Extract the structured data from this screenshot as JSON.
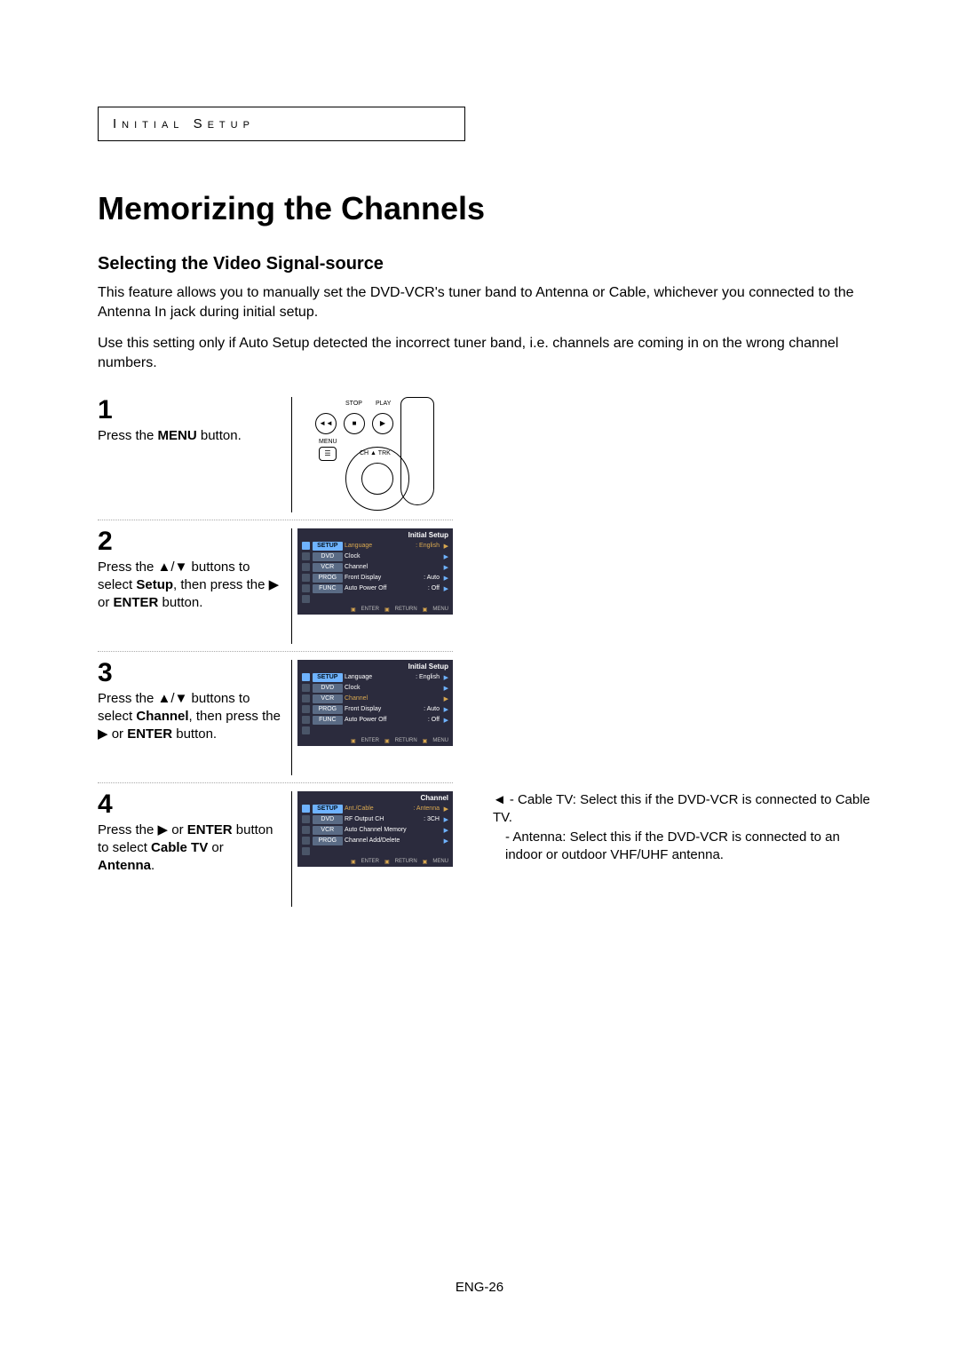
{
  "header": {
    "section": "Initial Setup"
  },
  "title": "Memorizing the Channels",
  "subtitle": "Selecting the Video Signal-source",
  "intro1": "This feature allows you to manually set the DVD-VCR's tuner band to Antenna or Cable, whichever you connected to the Antenna In jack during initial setup.",
  "intro2": "Use this setting only if Auto Setup detected the incorrect tuner band, i.e. channels are coming in on the wrong channel numbers.",
  "steps": {
    "s1": {
      "num": "1",
      "text_before": "Press the ",
      "bold1": "MENU",
      "text_after": " button."
    },
    "s2": {
      "num": "2",
      "text_a": "Press the ▲/▼ buttons to select ",
      "bold1": "Setup",
      "text_b": ", then press the ▶ or ",
      "bold2": "ENTER",
      "text_c": " button."
    },
    "s3": {
      "num": "3",
      "text_a": "Press the ▲/▼ buttons to select ",
      "bold1": "Channel",
      "text_b": ", then press the ▶ or ",
      "bold2": "ENTER",
      "text_c": " button."
    },
    "s4": {
      "num": "4",
      "text_a": "Press the ▶ or ",
      "bold1": "ENTER",
      "text_b": " button to select ",
      "bold2": "Cable TV",
      "text_c": " or ",
      "bold3": "Antenna",
      "text_d": "."
    }
  },
  "notes": {
    "n1": "Cable TV: Select this if the DVD-VCR is connected to Cable TV.",
    "n2": "Antenna: Select this if the DVD-VCR is connected to an indoor or outdoor VHF/UHF antenna."
  },
  "remote": {
    "stop": "STOP",
    "play": "PLAY",
    "menu": "MENU",
    "chtrk": "CH ▲ TRK"
  },
  "osd_sidebar": [
    "SETUP",
    "DVD",
    "VCR",
    "PROG",
    "FUNC"
  ],
  "osd2": {
    "title": "Initial Setup",
    "rows": [
      {
        "label": "Language",
        "val": ": English",
        "sel": true
      },
      {
        "label": "Clock",
        "val": ""
      },
      {
        "label": "Channel",
        "val": ""
      },
      {
        "label": "Front Display",
        "val": ": Auto"
      },
      {
        "label": "Auto Power Off",
        "val": ": Off"
      }
    ]
  },
  "osd3": {
    "title": "Initial Setup",
    "rows": [
      {
        "label": "Language",
        "val": ": English"
      },
      {
        "label": "Clock",
        "val": ""
      },
      {
        "label": "Channel",
        "val": "",
        "sel": true
      },
      {
        "label": "Front Display",
        "val": ": Auto"
      },
      {
        "label": "Auto Power Off",
        "val": ": Off"
      }
    ]
  },
  "osd4": {
    "title": "Channel",
    "rows": [
      {
        "label": "Ant./Cable",
        "val": ": Antenna",
        "sel": true
      },
      {
        "label": "RF Output CH",
        "val": ": 3CH"
      },
      {
        "label": "Auto Channel Memory",
        "val": ""
      },
      {
        "label": "Channel Add/Delete",
        "val": ""
      }
    ]
  },
  "osd_footer": {
    "enter": "ENTER",
    "return": "RETURN",
    "menu": "MENU"
  },
  "page_number": "ENG-26"
}
